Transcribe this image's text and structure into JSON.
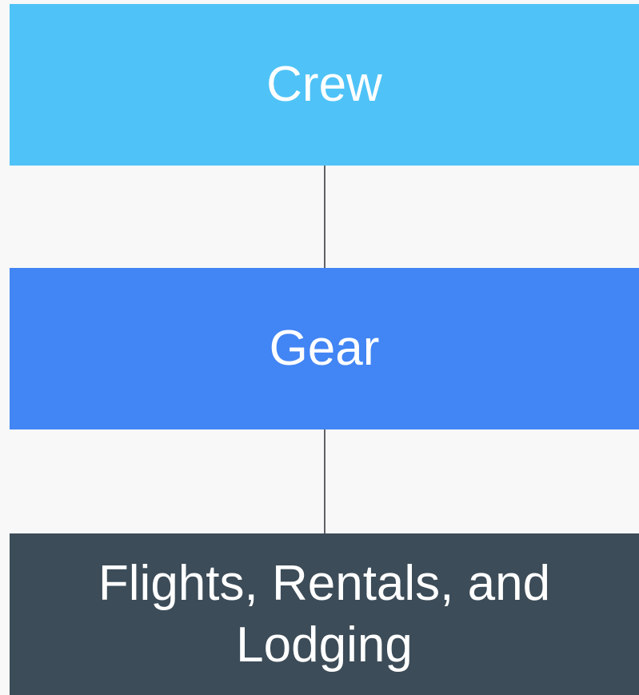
{
  "diagram": {
    "nodes": [
      {
        "label": "Crew",
        "color": "#4fc3f7"
      },
      {
        "label": "Gear",
        "color": "#4285f4"
      },
      {
        "label": "Flights, Rentals, and Lodging",
        "color": "#3c4c58"
      }
    ],
    "connector_color": "#5f6368",
    "background": "#f8f8f8"
  }
}
